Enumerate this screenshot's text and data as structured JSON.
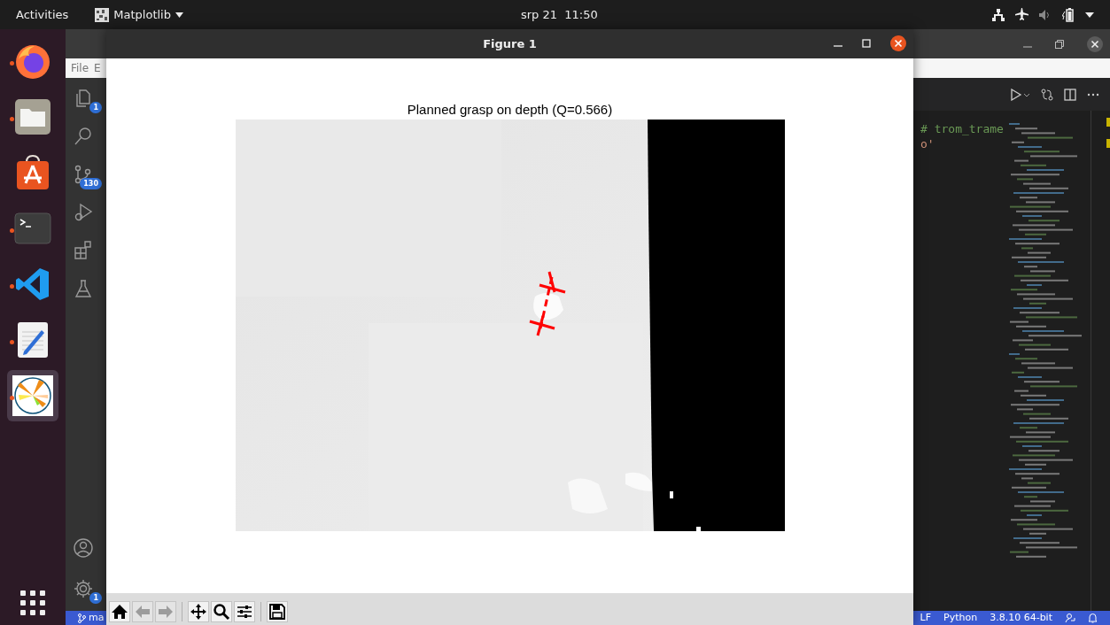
{
  "top_bar": {
    "activities": "Activities",
    "app_menu": "Matplotlib",
    "clock": "srp 21  11:50"
  },
  "dock": {
    "items": [
      {
        "kind": "firefox",
        "running": true,
        "selected": false
      },
      {
        "kind": "files",
        "running": true,
        "selected": false
      },
      {
        "kind": "software",
        "running": false,
        "selected": false
      },
      {
        "kind": "terminal",
        "running": true,
        "selected": false
      },
      {
        "kind": "vscode",
        "running": true,
        "selected": false
      },
      {
        "kind": "editor",
        "running": true,
        "selected": false
      },
      {
        "kind": "matplotlib",
        "running": true,
        "selected": true
      }
    ]
  },
  "editor_window": {
    "menu": [
      "File",
      "E"
    ],
    "activity_bar": [
      {
        "kind": "explorer",
        "badge": "1"
      },
      {
        "kind": "search"
      },
      {
        "kind": "source-control",
        "badge": "130"
      },
      {
        "kind": "run"
      },
      {
        "kind": "extensions"
      },
      {
        "kind": "testing"
      }
    ],
    "activity_bar_bottom": [
      {
        "kind": "account"
      },
      {
        "kind": "settings",
        "badge": "1"
      }
    ],
    "code_lines": [
      "# trom_trame",
      "o'"
    ],
    "status_bar": {
      "branch": "ma",
      "items": [
        "LF",
        "Python",
        "3.8.10 64-bit"
      ]
    }
  },
  "figure_window": {
    "title": "Figure 1",
    "plot_title": "Planned grasp on depth (Q=0.566)",
    "toolbar": [
      {
        "kind": "home",
        "disabled": false
      },
      {
        "kind": "back",
        "disabled": true
      },
      {
        "kind": "forward",
        "disabled": true
      },
      {
        "kind": "separator"
      },
      {
        "kind": "pan",
        "disabled": false
      },
      {
        "kind": "zoom",
        "disabled": false
      },
      {
        "kind": "configure",
        "disabled": false
      },
      {
        "kind": "separator"
      },
      {
        "kind": "save",
        "disabled": false
      }
    ]
  }
}
